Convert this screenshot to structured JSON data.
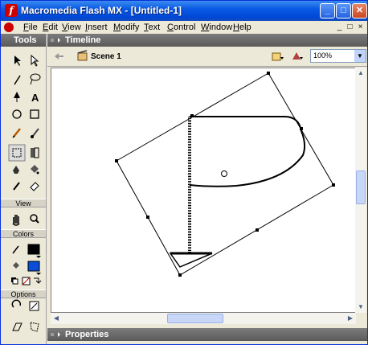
{
  "window": {
    "title": "Macromedia Flash MX - [Untitled-1]",
    "app_icon_glyph": "f"
  },
  "window_controls": {
    "minimize": "_",
    "maximize": "□",
    "close": "✕"
  },
  "menubar": {
    "items": [
      "File",
      "Edit",
      "View",
      "Insert",
      "Modify",
      "Text",
      "Control",
      "Window",
      "Help"
    ],
    "mdi": [
      "_",
      "□",
      "×"
    ]
  },
  "tools_panel": {
    "title": "Tools",
    "view_label": "View",
    "colors_label": "Colors",
    "options_label": "Options",
    "stroke_color": "#000000",
    "fill_color": "#0a4ed8"
  },
  "timeline": {
    "title": "Timeline"
  },
  "scenebar": {
    "scene_label": "Scene 1",
    "zoom_value": "100%"
  },
  "properties": {
    "title": "Properties"
  },
  "icons": {
    "panel_menu": "grip-icon",
    "collapse": "triangle-right-icon",
    "back": "back-arrow-icon",
    "scene": "scene-clapper-icon"
  }
}
